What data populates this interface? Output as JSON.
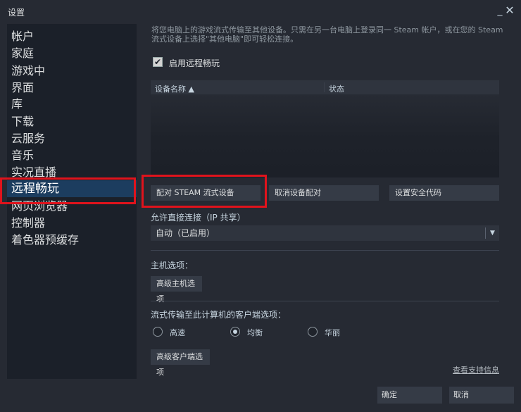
{
  "window": {
    "title": "设置",
    "minimize": "_",
    "close": "✕"
  },
  "sidebar": {
    "items": [
      {
        "label": "帐户"
      },
      {
        "label": "家庭"
      },
      {
        "label": "游戏中"
      },
      {
        "label": "界面"
      },
      {
        "label": "库"
      },
      {
        "label": "下载"
      },
      {
        "label": "云服务"
      },
      {
        "label": "音乐"
      },
      {
        "label": "实况直播"
      },
      {
        "label": "远程畅玩",
        "active": true
      },
      {
        "label": "网页浏览器"
      },
      {
        "label": "控制器"
      },
      {
        "label": "着色器预缓存"
      }
    ]
  },
  "remote_play": {
    "description": "将您电脑上的游戏流式传输至其他设备。只需在另一台电脑上登录同一 Steam 帐户，或在您的 Steam 流式设备上选择\"其他电脑\"即可轻松连接。",
    "enable_label": "启用远程畅玩",
    "enable_checked": true,
    "check_mark": "✔",
    "device_list": {
      "col_name": "设备名称 ▲",
      "col_status": "状态"
    },
    "pair_button": "配对 STEAM 流式设备",
    "unpair_button": "取消设备配对",
    "security_code_button": "设置安全代码",
    "direct_connect_label": "允许直接连接（IP 共享）",
    "direct_connect_value": "自动（已启用）",
    "dropdown_arrow": "▼",
    "host_options_label": "主机选项：",
    "host_advanced_button": "高级主机选项",
    "client_options_label": "流式传输至此计算机的客户端选项：",
    "quality_options": [
      {
        "label": "高速",
        "checked": false
      },
      {
        "label": "均衡",
        "checked": true
      },
      {
        "label": "华丽",
        "checked": false
      }
    ],
    "client_advanced_button": "高级客户端选项",
    "support_link": "查看支持信息"
  },
  "footer": {
    "ok": "确定",
    "cancel": "取消"
  },
  "colors": {
    "highlight_box": "#e0131c",
    "active_nav": "#1c3d5f"
  }
}
